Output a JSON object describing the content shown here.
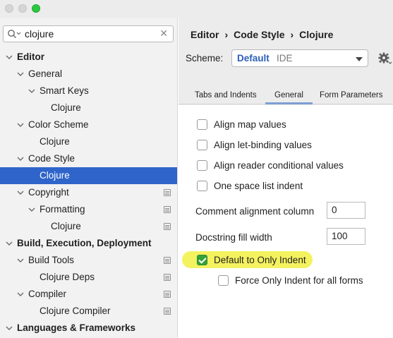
{
  "search": {
    "value": "clojure"
  },
  "tree": [
    {
      "label": "Editor",
      "bold": true,
      "level": 0,
      "expanded": true
    },
    {
      "label": "General",
      "level": 1,
      "expanded": true
    },
    {
      "label": "Smart Keys",
      "level": 2,
      "expanded": true
    },
    {
      "label": "Clojure",
      "level": 3
    },
    {
      "label": "Color Scheme",
      "level": 1,
      "expanded": true
    },
    {
      "label": "Clojure",
      "level": 2
    },
    {
      "label": "Code Style",
      "level": 1,
      "expanded": true
    },
    {
      "label": "Clojure",
      "level": 2,
      "selected": true
    },
    {
      "label": "Copyright",
      "level": 1,
      "expanded": true,
      "doc": true
    },
    {
      "label": "Formatting",
      "level": 2,
      "expanded": true,
      "doc": true
    },
    {
      "label": "Clojure",
      "level": 3,
      "doc": true
    },
    {
      "label": "Build, Execution, Deployment",
      "bold": true,
      "level": 0,
      "expanded": true
    },
    {
      "label": "Build Tools",
      "level": 1,
      "expanded": true,
      "doc": true
    },
    {
      "label": "Clojure Deps",
      "level": 2,
      "doc": true
    },
    {
      "label": "Compiler",
      "level": 1,
      "expanded": true,
      "doc": true
    },
    {
      "label": "Clojure Compiler",
      "level": 2,
      "doc": true
    },
    {
      "label": "Languages & Frameworks",
      "bold": true,
      "level": 0,
      "expanded": true
    }
  ],
  "breadcrumb": [
    "Editor",
    "Code Style",
    "Clojure"
  ],
  "scheme": {
    "label": "Scheme:",
    "name": "Default",
    "kind": "IDE"
  },
  "tabs": [
    "Tabs and Indents",
    "General",
    "Form Parameters"
  ],
  "active_tab": "General",
  "options": {
    "align_map_values": {
      "label": "Align map values",
      "checked": false
    },
    "align_let_binding": {
      "label": "Align let-binding values",
      "checked": false
    },
    "align_reader_cond": {
      "label": "Align reader conditional values",
      "checked": false
    },
    "one_space_list": {
      "label": "One space list indent",
      "checked": false
    },
    "comment_alignment": {
      "label": "Comment alignment column",
      "value": "0"
    },
    "docstring_fill": {
      "label": "Docstring fill width",
      "value": "100"
    },
    "default_only_indent": {
      "label": "Default to Only Indent",
      "checked": true
    },
    "force_only_indent": {
      "label": "Force Only Indent for all forms",
      "checked": false
    }
  },
  "colors": {
    "selection": "#2f65ca",
    "scheme_name": "#2d5fb8",
    "checkbox_on": "#36a13a",
    "highlight": "#f4f25f"
  }
}
